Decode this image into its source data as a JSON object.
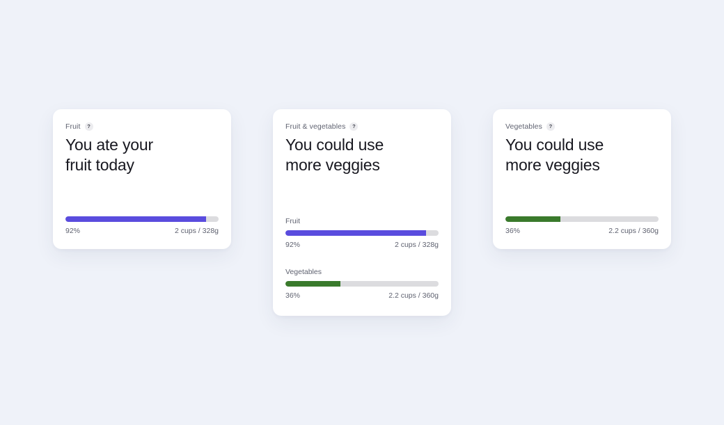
{
  "colors": {
    "fruit": "#5a4cde",
    "vegetables": "#3a7a2c",
    "track": "#dcdcdf",
    "background": "#eff2f9",
    "help_icon": "question-mark-icon"
  },
  "cards": [
    {
      "category": "Fruit",
      "help": "?",
      "headline_line1": "You ate your",
      "headline_line2": "fruit today",
      "metrics": [
        {
          "label": "",
          "percent": 92,
          "percent_label": "92%",
          "amount": "2 cups / 328g",
          "color": "#5a4cde"
        }
      ]
    },
    {
      "category": "Fruit & vegetables",
      "help": "?",
      "headline_line1": "You could use",
      "headline_line2": "more veggies",
      "metrics": [
        {
          "label": "Fruit",
          "percent": 92,
          "percent_label": "92%",
          "amount": "2 cups / 328g",
          "color": "#5a4cde"
        },
        {
          "label": "Vegetables",
          "percent": 36,
          "percent_label": "36%",
          "amount": "2.2 cups / 360g",
          "color": "#3a7a2c"
        }
      ]
    },
    {
      "category": "Vegetables",
      "help": "?",
      "headline_line1": "You could use",
      "headline_line2": "more veggies",
      "metrics": [
        {
          "label": "",
          "percent": 36,
          "percent_label": "36%",
          "amount": "2.2 cups / 360g",
          "color": "#3a7a2c"
        }
      ]
    }
  ]
}
